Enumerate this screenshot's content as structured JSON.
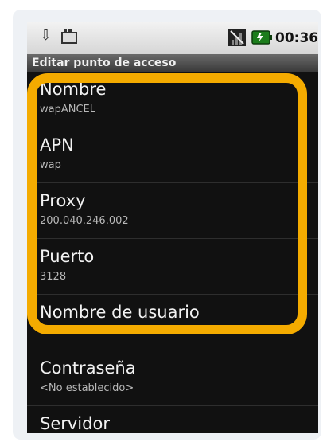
{
  "status_bar": {
    "time": "00:36",
    "icons": [
      "download-icon",
      "photo-icon",
      "no-signal-icon",
      "battery-charging-icon"
    ]
  },
  "title": "Editar punto de acceso",
  "settings": [
    {
      "title": "Nombre",
      "value": "wapANCEL"
    },
    {
      "title": "APN",
      "value": "wap"
    },
    {
      "title": "Proxy",
      "value": "200.040.246.002"
    },
    {
      "title": "Puerto",
      "value": "3128"
    },
    {
      "title": "Nombre de usuario",
      "value": ""
    },
    {
      "title": "Contraseña",
      "value": "<No establecido>"
    },
    {
      "title": "Servidor",
      "value": ""
    }
  ],
  "colors": {
    "highlight": "#f4ab00",
    "list_background": "#111111",
    "status_bar": "#e4e4e4"
  }
}
